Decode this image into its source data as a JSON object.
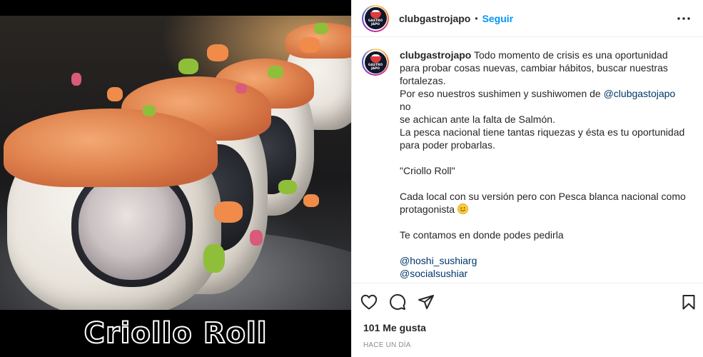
{
  "media": {
    "overlay_title": "Criollo Roll"
  },
  "post": {
    "username": "clubgastrojapo",
    "separator": "•",
    "follow_label": "Seguir",
    "more_icon": "more-horizontal-icon",
    "avatar_text_1": "GASTRO",
    "avatar_text_2": "JAPO",
    "caption": {
      "username": "clubgastrojapo",
      "line1": " Todo momento de crisis es una oportunidad",
      "line2": "para probar cosas nuevas, cambiar hábitos, buscar nuestras",
      "line3": "fortalezas.",
      "line4_pre": "Por eso nuestros sushimen y sushiwomen de ",
      "line4_link": "@clubgastojapo",
      "line4_post": " no",
      "line5": "se achican ante la falta de Salmón.",
      "line6": "La pesca nacional tiene tantas riquezas y ésta es tu oportunidad",
      "line7": "para poder probarlas.",
      "line8": "\"Criollo Roll\"",
      "line9": "Cada local con su versión pero con Pesca blanca nacional como",
      "line10": "protagonista ",
      "line11": "Te contamos en donde podes pedirla",
      "mention1": "@hoshi_sushiarg",
      "mention2": "@socialsushiar"
    },
    "actions": {
      "like_icon": "heart-icon",
      "comment_icon": "comment-icon",
      "share_icon": "share-icon",
      "save_icon": "bookmark-icon"
    },
    "likes": "101 Me gusta",
    "timestamp": "HACE UN DÍA"
  },
  "colors": {
    "link": "#00376b",
    "follow": "#0095f6",
    "muted": "#8e8e8e"
  }
}
